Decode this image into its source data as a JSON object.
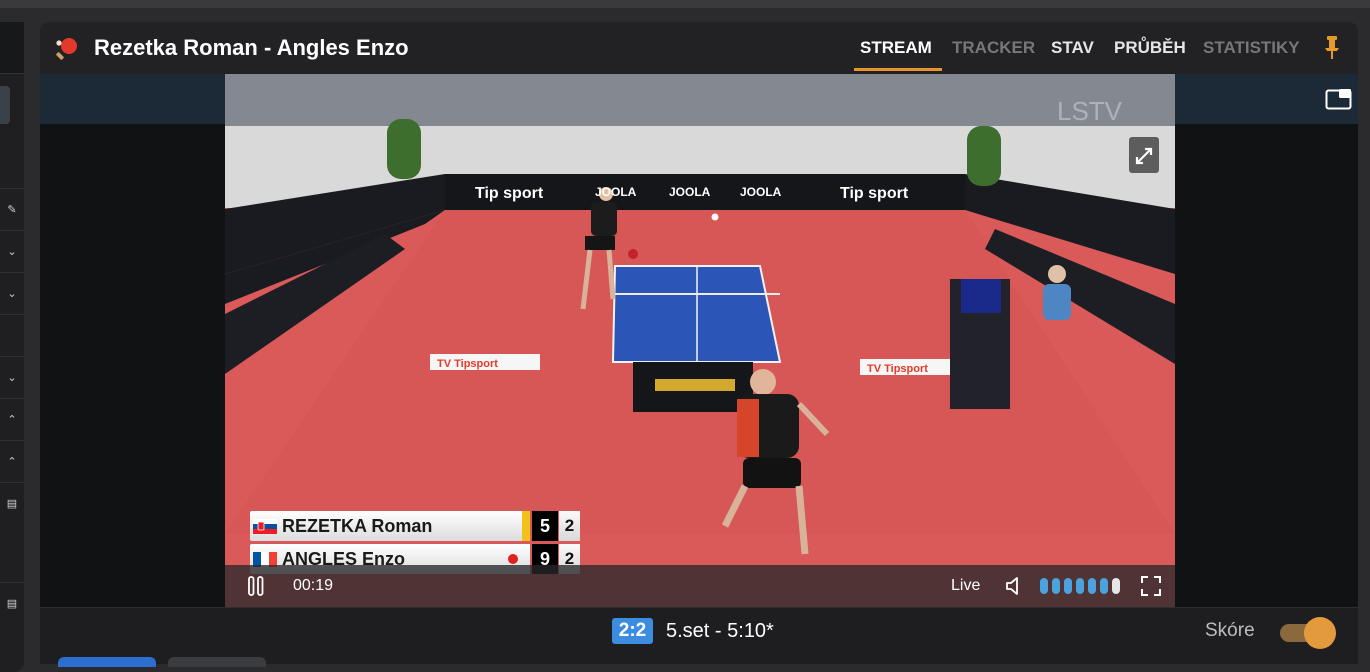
{
  "header": {
    "title": "Rezetka Roman - Angles Enzo",
    "icon": "table-tennis-paddle-icon",
    "tabs": [
      {
        "label": "STREAM",
        "active": true
      },
      {
        "label": "TRACKER",
        "active": false
      },
      {
        "label": "STAV",
        "active": false
      },
      {
        "label": "PRŮBĚH",
        "active": false
      },
      {
        "label": "STATISTIKY",
        "active": false
      }
    ],
    "pin_icon": "pin-icon"
  },
  "stream": {
    "watermark": "LSTV",
    "banners": {
      "tipsport": "Tip sport",
      "joola": "JOOLA",
      "tv_tipsport": "TV Tipsport"
    },
    "scoreboard": [
      {
        "flag": "SK",
        "name": "REZETKA Roman",
        "points": "5",
        "sets": "2",
        "serving": false
      },
      {
        "flag": "FR",
        "name": "ANGLES Enzo",
        "points": "9",
        "sets": "2",
        "serving": true
      }
    ],
    "controls": {
      "time": "00:19",
      "live_label": "Live",
      "play_state": "paused-icon",
      "volume_level": 0.85
    }
  },
  "footer": {
    "sets_score": "2:2",
    "set_status": "5.set - 5:10*",
    "score_label": "Skóre",
    "score_toggle_on": true
  },
  "colors": {
    "accent": "#e8942c",
    "badge": "#3c8ce0",
    "floor": "#d85a5a"
  }
}
